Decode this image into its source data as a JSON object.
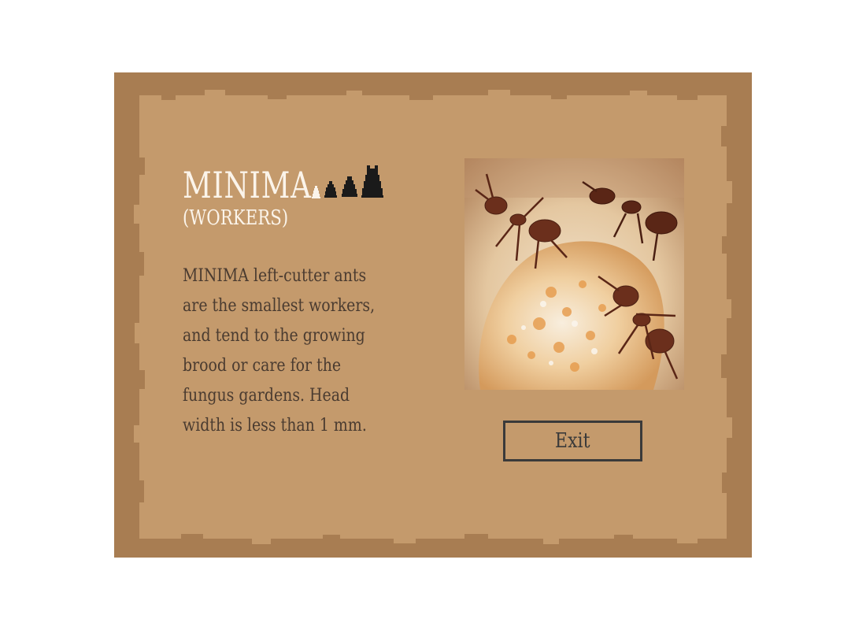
{
  "card": {
    "title": "MINIMA",
    "subtitle": "(WORKERS)",
    "description": "MINIMA left-cutter ants are the smallest workers, and tend to the growing brood or care for the fungus gardens. Head width is less than 1 mm.",
    "caste_icons": [
      {
        "name": "minima-ant-icon",
        "highlighted": true
      },
      {
        "name": "minor-ant-icon",
        "highlighted": false
      },
      {
        "name": "media-ant-icon",
        "highlighted": false
      },
      {
        "name": "major-ant-icon",
        "highlighted": false
      }
    ],
    "photo_icon": "leafcutter-ants-on-fungus-photo",
    "exit_label": "Exit"
  },
  "colors": {
    "frame": "#a87d52",
    "panel": "#c49a6c",
    "title": "#fbf4ea",
    "text": "#4a3b30",
    "button_border": "#3a3a3a"
  }
}
